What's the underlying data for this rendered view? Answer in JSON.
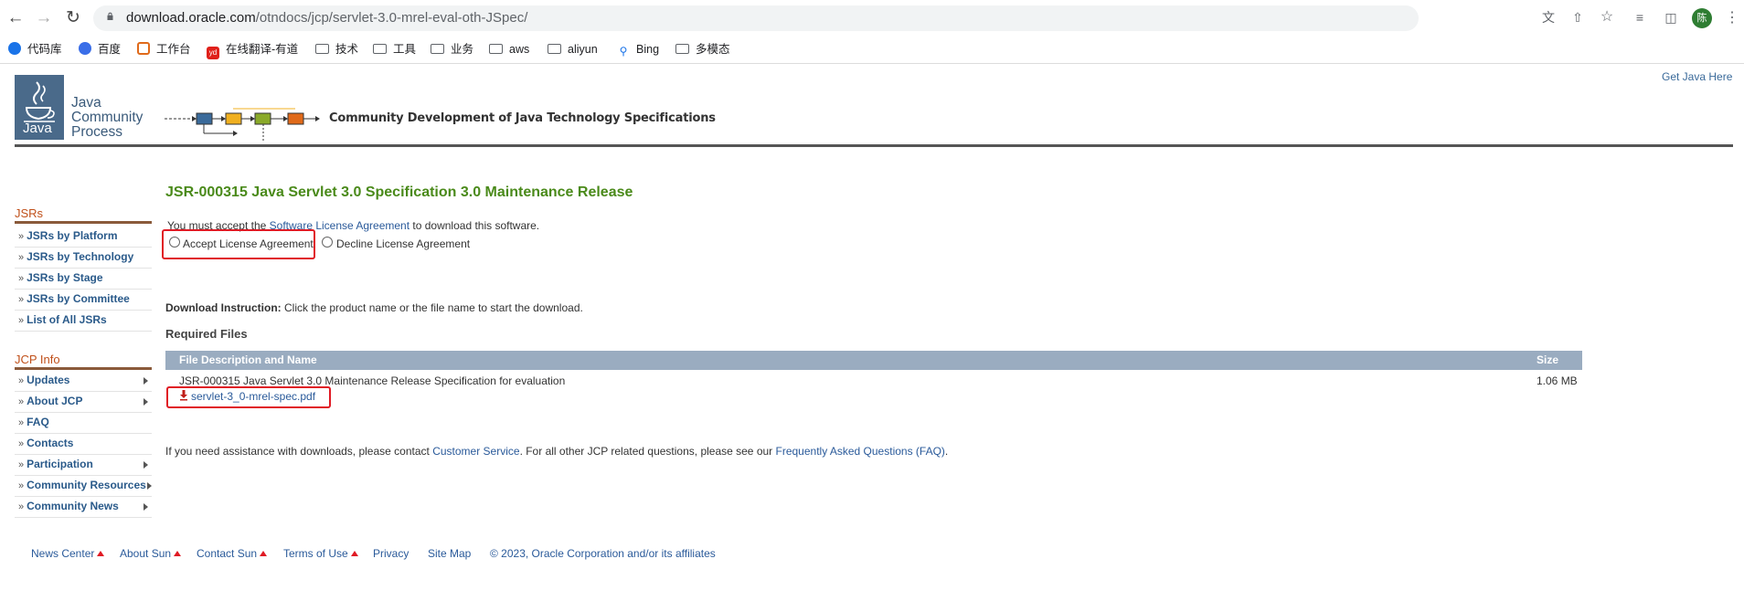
{
  "browser": {
    "url_domain": "download.oracle.com",
    "url_path": "/otndocs/jcp/servlet-3.0-mrel-eval-oth-JSpec/",
    "profile_initial": "陈",
    "bookmarks": [
      "代码库",
      "百度",
      "工作台",
      "在线翻译-有道",
      "技术",
      "工具",
      "业务",
      "aws",
      "aliyun",
      "Bing",
      "多模态"
    ],
    "youdao_badge": "yd"
  },
  "header": {
    "logo_java": "Java",
    "logo_lines": [
      "Java",
      "Community",
      "Process"
    ],
    "tagline": "Community Development of Java Technology Specifications",
    "get_java": "Get Java Here"
  },
  "sidebar": {
    "jsrs_title": "JSRs",
    "jsrs_items": [
      "JSRs by Platform",
      "JSRs by Technology",
      "JSRs by Stage",
      "JSRs by Committee",
      "List of All JSRs"
    ],
    "jcp_title": "JCP Info",
    "jcp_items": [
      "Updates",
      "About JCP",
      "FAQ",
      "Contacts",
      "Participation",
      "Community Resources",
      "Community News"
    ],
    "raquo": "»"
  },
  "main": {
    "title": "JSR-000315 Java Servlet 3.0 Specification 3.0 Maintenance Release",
    "license_prefix": "You must accept the ",
    "license_link": "Software License Agreement",
    "license_suffix": " to download this software.",
    "accept_label": "Accept License Agreement",
    "decline_label": "Decline License Agreement",
    "instruction_bold": "Download Instruction:",
    "instruction_text": " Click the product name or the file name to start the download.",
    "required_files": "Required Files",
    "col_desc": "File Description and Name",
    "col_size": "Size",
    "file_desc": "JSR-000315 Java Servlet 3.0 Maintenance Release Specification for evaluation",
    "file_size": "1.06 MB",
    "file_name": "servlet-3_0-mrel-spec.pdf",
    "assist_prefix": "If you need assistance with downloads, please contact ",
    "assist_link1": "Customer Service",
    "assist_mid": ". For all other JCP related questions, please see our ",
    "assist_link2": "Frequently Asked Questions (FAQ)",
    "assist_suffix": "."
  },
  "footer": {
    "news_center": "News Center",
    "about_sun": "About Sun",
    "contact_sun": "Contact Sun",
    "terms": "Terms of Use",
    "privacy": "Privacy",
    "sitemap": "Site Map",
    "copyright": "© 2023, Oracle Corporation and/or its affiliates"
  },
  "colors": {
    "title_green": "#4a8a1a",
    "link_blue": "#2a5a9a",
    "highlight_red": "#e01a24",
    "table_header": "#9aacc0"
  }
}
